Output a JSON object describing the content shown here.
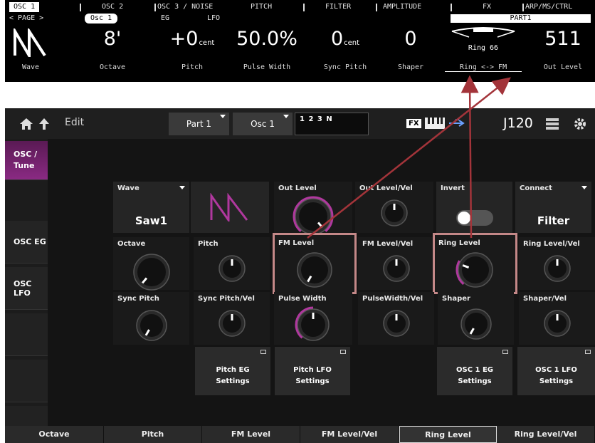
{
  "oled": {
    "tabs": [
      "OSC 1",
      "OSC 2",
      "OSC 3 / NOISE",
      "PITCH",
      "FILTER",
      "AMPLITUDE",
      "FX",
      "ARP/MS/CTRL"
    ],
    "page_label": "< PAGE >",
    "subtabs": [
      "Osc 1",
      "EG",
      "LFO"
    ],
    "part": "PART1",
    "params": [
      {
        "value": "8'",
        "unit": "",
        "label": "Octave"
      },
      {
        "value": "+0",
        "unit": "cent",
        "label": "Pitch"
      },
      {
        "value": "50.0%",
        "unit": "",
        "label": "Pulse Width"
      },
      {
        "value": "0",
        "unit": "cent",
        "label": "Sync Pitch"
      },
      {
        "value": "0",
        "unit": "",
        "label": "Shaper"
      },
      {
        "value": "Ring 66",
        "unit": "",
        "label": "Ring <-> FM"
      },
      {
        "value": "511",
        "unit": "",
        "label": "Out Level"
      }
    ],
    "wave_label": "Wave"
  },
  "header": {
    "edit": "Edit",
    "part_button": "Part 1",
    "osc_button": "Osc 1",
    "info_box": "1 2 3 N",
    "fx_badge": "FX",
    "tempo": "♩20",
    "tempo_text": "J120"
  },
  "sidebar": [
    "OSC /\nTune",
    "OSC EG",
    "OSC LFO"
  ],
  "cells": {
    "wave": {
      "label": "Wave",
      "value": "Saw1"
    },
    "out_level": "Out Level",
    "out_level_vel": "Out Level/Vel",
    "invert": "Invert",
    "connect": {
      "label": "Connect",
      "value": "Filter"
    },
    "octave": "Octave",
    "pitch": "Pitch",
    "fm_level": "FM Level",
    "fm_level_vel": "FM Level/Vel",
    "ring_level": "Ring Level",
    "ring_level_vel": "Ring Level/Vel",
    "sync_pitch": "Sync Pitch",
    "sync_pitch_vel": "Sync Pitch/Vel",
    "pulse_width": "Pulse Width",
    "pulse_width_vel": "PulseWidth/Vel",
    "shaper": "Shaper",
    "shaper_vel": "Shaper/Vel"
  },
  "settings_buttons": [
    {
      "line1": "Pitch EG",
      "line2": "Settings"
    },
    {
      "line1": "Pitch LFO",
      "line2": "Settings"
    },
    {
      "line1": "OSC 1 EG",
      "line2": "Settings"
    },
    {
      "line1": "OSC 1 LFO",
      "line2": "Settings"
    }
  ],
  "bottom_tabs": [
    "Octave",
    "Pitch",
    "FM Level",
    "FM Level/Vel",
    "Ring Level",
    "Ring Level/Vel"
  ],
  "colors": {
    "accent": "#b0389e",
    "highlight": "#c48888",
    "arrow": "#a3343a"
  }
}
